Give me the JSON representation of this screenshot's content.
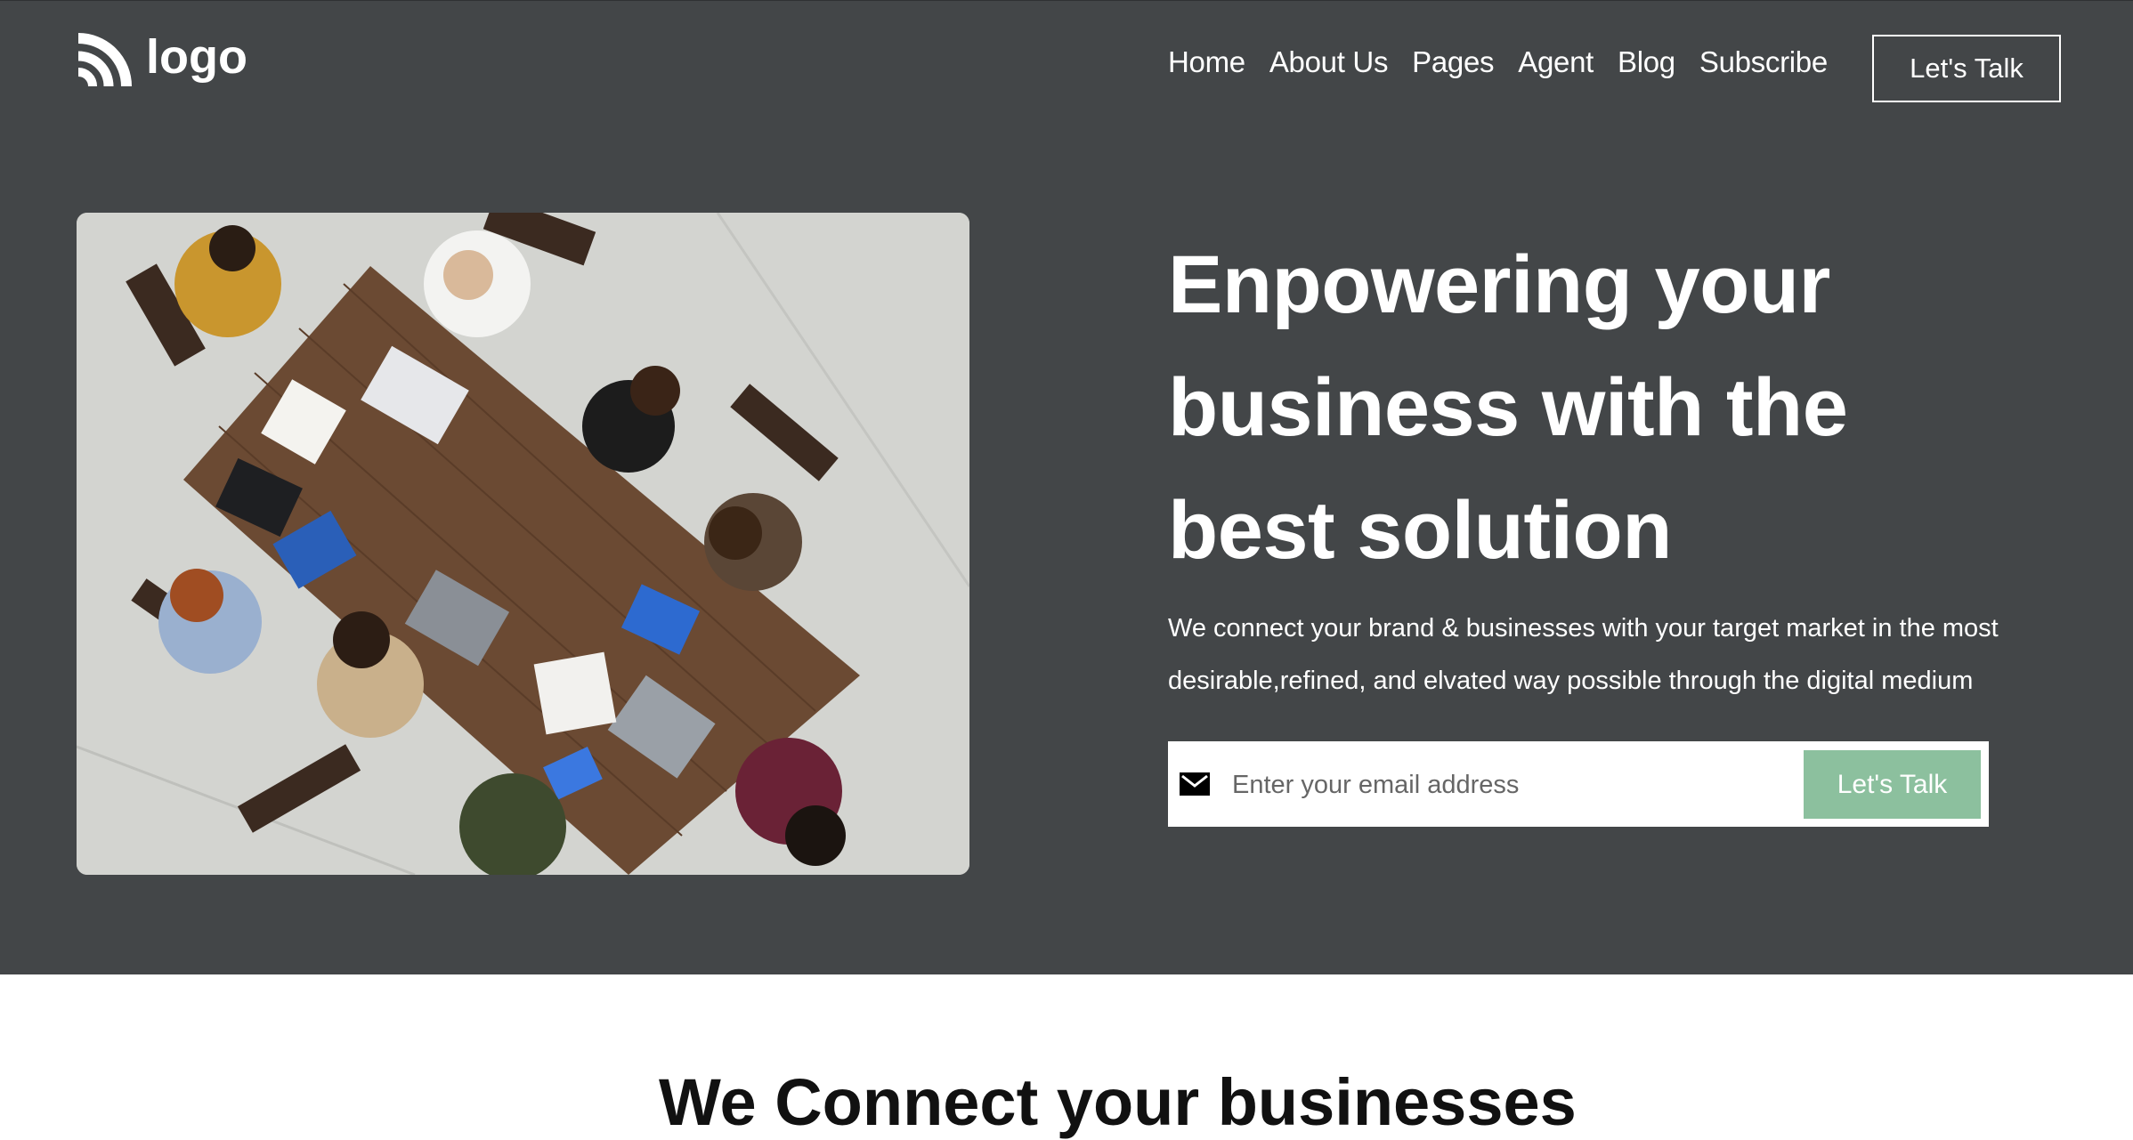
{
  "logo": {
    "text": "logo",
    "icon": "wifi-arcs-icon"
  },
  "nav": {
    "items": [
      "Home",
      "About Us",
      "Pages",
      "Agent",
      "Blog",
      "Subscribe"
    ]
  },
  "header_cta": "Let's Talk",
  "hero": {
    "headline_lines": [
      "Enpowering your",
      "business with the",
      "best solution"
    ],
    "description": "We connect your brand & businesses with your target market in the most desirable,refined, and elvated way possible through the digital medium",
    "email_placeholder": "Enter your email address",
    "cta": "Let's Talk",
    "image": "team-meeting-photo"
  },
  "next_section": {
    "heading": "We Connect your businesses"
  },
  "colors": {
    "hero_bg": "#434648",
    "accent": "#8cc09e",
    "text": "#ffffff"
  }
}
